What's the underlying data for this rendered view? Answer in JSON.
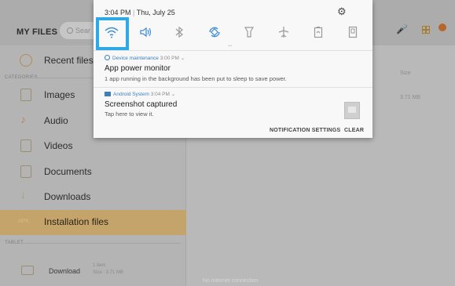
{
  "app": {
    "title": "MY FILES",
    "search_placeholder": "Sear",
    "sections": {
      "categories": "CATEGORIES",
      "tablet": "TABLET"
    },
    "sidebar": [
      {
        "label": "Recent files",
        "icon": "clock-icon"
      },
      {
        "label": "Images",
        "icon": "image-icon"
      },
      {
        "label": "Audio",
        "icon": "music-note-icon"
      },
      {
        "label": "Videos",
        "icon": "video-icon"
      },
      {
        "label": "Documents",
        "icon": "document-icon"
      },
      {
        "label": "Downloads",
        "icon": "download-icon"
      },
      {
        "label": "Installation files",
        "icon": "apk-icon",
        "icon_text": "APK",
        "active": true
      }
    ],
    "main": {
      "size_header": "Size",
      "size_value": "3.71 MB"
    },
    "tablet_item": {
      "label": "Download",
      "items": "1 item",
      "size": "Size : 3.71 MB"
    },
    "bottom_status": "No Internet connection",
    "colors": {
      "accent": "#c4a46a",
      "highlight_box": "#2fa8e6",
      "link_blue": "#3f7fbd"
    }
  },
  "shade": {
    "time": "3:04 PM",
    "date": "Thu, July 25",
    "quick_settings": [
      {
        "name": "wifi",
        "icon": "wifi-icon",
        "active": true
      },
      {
        "name": "sound",
        "icon": "speaker-icon",
        "active": true
      },
      {
        "name": "bluetooth",
        "icon": "bluetooth-icon",
        "active": false
      },
      {
        "name": "auto-rotate",
        "icon": "rotate-icon",
        "active": true
      },
      {
        "name": "flashlight",
        "icon": "flashlight-icon",
        "active": false
      },
      {
        "name": "airplane",
        "icon": "airplane-icon",
        "active": false
      },
      {
        "name": "power-saving",
        "icon": "battery-icon",
        "active": false
      },
      {
        "name": "blue-light",
        "icon": "blue-light-icon",
        "active": false
      }
    ],
    "notifications": [
      {
        "app": "Device maintenance",
        "time": "3:00 PM",
        "title": "App power monitor",
        "body": "1 app running in the background has been put to sleep to save power."
      },
      {
        "app": "Android System",
        "time": "3:04 PM",
        "title": "Screenshot captured",
        "body": "Tap here to view it."
      }
    ],
    "actions": {
      "settings": "NOTIFICATION SETTINGS",
      "clear": "CLEAR"
    }
  }
}
